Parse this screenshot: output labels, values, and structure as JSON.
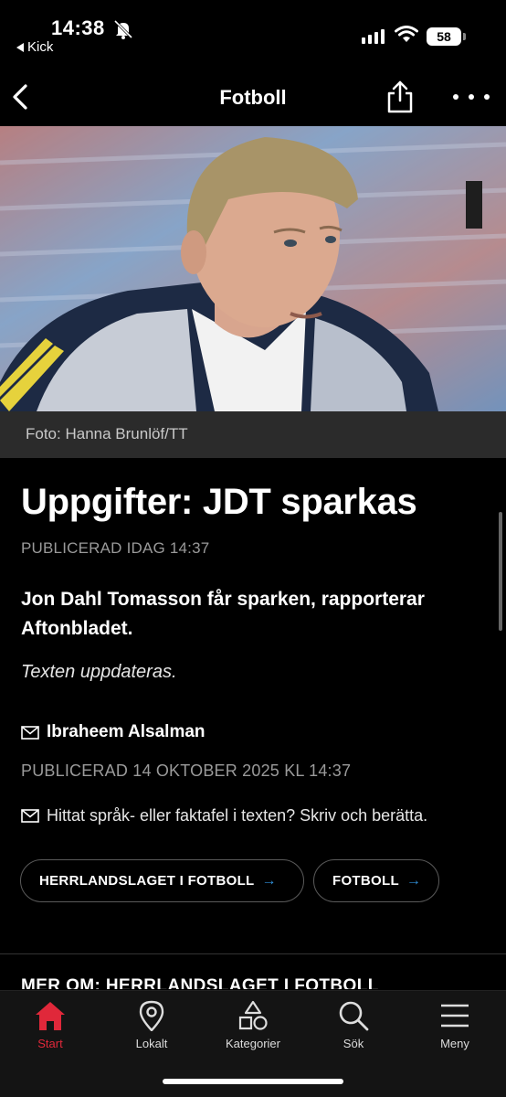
{
  "status_bar": {
    "time": "14:38",
    "back_app": "Kick",
    "battery": "58"
  },
  "navbar": {
    "title": "Fotboll"
  },
  "hero": {
    "caption": "Foto: Hanna Brunlöf/TT"
  },
  "article": {
    "headline": "Uppgifter: JDT sparkas",
    "published_top": "PUBLICERAD IDAG 14:37",
    "lead": "Jon Dahl Tomasson får sparken, rapporterar Aftonbladet.",
    "update_note": "Texten uppdateras.",
    "author": "Ibraheem Alsalman",
    "published_full": "PUBLICERAD 14 OKTOBER 2025 KL 14:37",
    "report_prompt": "Hittat språk- eller faktafel i texten? Skriv och berätta.",
    "tags": [
      {
        "label": "HERRLANDSLAGET I FOTBOLL",
        "arrow": "→"
      },
      {
        "label": "FOTBOLL",
        "arrow": "→"
      }
    ],
    "more_about": "MER OM: HERRLANDSLAGET I FOTBOLL"
  },
  "tabbar": {
    "active": "Start",
    "items": [
      {
        "label": "Start",
        "icon": "home-icon"
      },
      {
        "label": "Lokalt",
        "icon": "location-pin-icon"
      },
      {
        "label": "Kategorier",
        "icon": "categories-icon"
      },
      {
        "label": "Sök",
        "icon": "search-icon"
      },
      {
        "label": "Meny",
        "icon": "menu-icon"
      }
    ]
  },
  "colors": {
    "background": "#000000",
    "accent_active": "#e0283a",
    "link_arrow": "#2f8fd8",
    "caption_bar": "#2b2b2b"
  }
}
